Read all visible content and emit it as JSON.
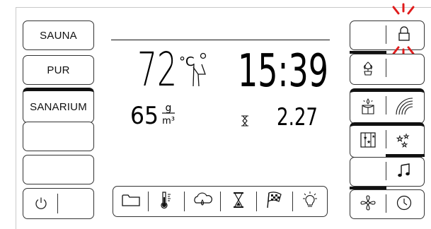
{
  "modes": {
    "items": [
      {
        "label": "SAUNA",
        "active": false
      },
      {
        "label": "PUR",
        "active": false
      },
      {
        "label": "SANARIUM",
        "active": true
      },
      {
        "label": "",
        "active": false
      },
      {
        "label": "",
        "active": false
      }
    ]
  },
  "display": {
    "temperature": "72",
    "temperature_unit": "°C",
    "time": "15:39",
    "humidity": "65",
    "humidity_unit_top": "g",
    "humidity_unit_bottom": "m³",
    "remaining": "2.27"
  },
  "icons": {
    "power": "power-icon",
    "lock": "lock-icon",
    "flower": "flower-icon",
    "aroma": "aroma-icon",
    "light_rainbow": "rainbow-icon",
    "star_panel": "star-panel-icon",
    "sparkles": "sparkles-icon",
    "music": "music-icon",
    "fan": "fan-icon",
    "clock": "clock-icon",
    "folder": "folder-icon",
    "thermometer": "thermometer-icon",
    "cloud_drop": "humidity-icon",
    "hourglass": "hourglass-icon",
    "flag": "flag-icon",
    "bulb": "bulb-icon",
    "seat": "seat-person-icon"
  },
  "colors": {
    "alert": "#e01c1c",
    "line": "#111111"
  }
}
